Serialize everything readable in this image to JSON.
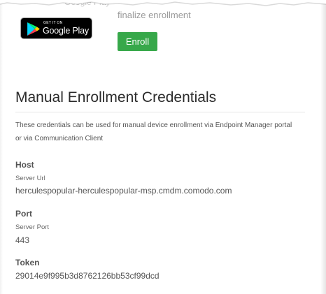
{
  "store": {
    "caption": "Google Play",
    "badge_small": "GET IT ON",
    "badge_big": "Google Play"
  },
  "enroll": {
    "text": "finalize enrollment",
    "button_label": "Enroll",
    "button_color": "#37a84a"
  },
  "manual": {
    "title": "Manual Enrollment Credentials",
    "description_line1": "These credentials can be used for manual device enrollment via Endpoint Manager portal",
    "description_line2": "or via Communication Client",
    "fields": [
      {
        "label": "Host",
        "sublabel": "Server Url",
        "value": "herculespopular-herculespopular-msp.cmdm.comodo.com"
      },
      {
        "label": "Port",
        "sublabel": "Server Port",
        "value": "443"
      },
      {
        "label": "Token",
        "sublabel": "",
        "value": "29014e9f995b3d8762126bb53cf99dcd"
      }
    ]
  }
}
